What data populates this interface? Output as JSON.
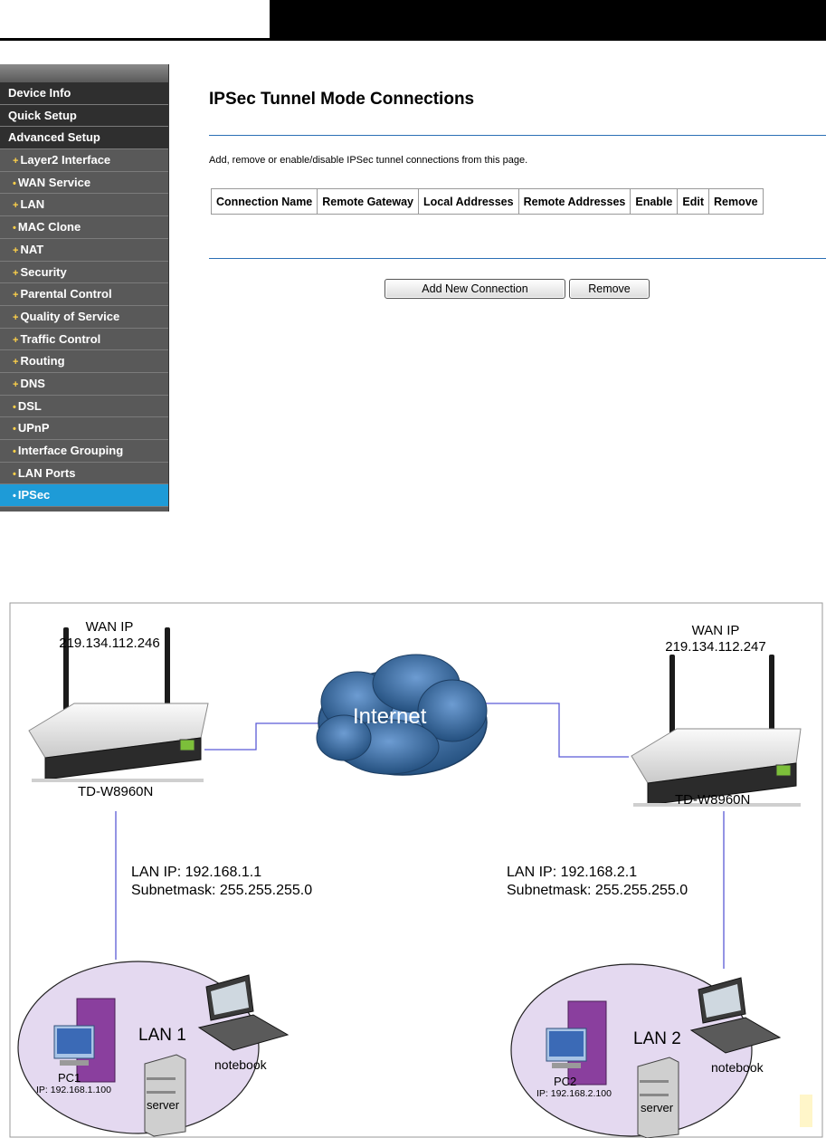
{
  "sidebar": {
    "items": [
      {
        "label": "Device Info",
        "level": "main"
      },
      {
        "label": "Quick Setup",
        "level": "main"
      },
      {
        "label": "Advanced Setup",
        "level": "main"
      },
      {
        "label": "Layer2 Interface",
        "level": "sub",
        "bullet": "+"
      },
      {
        "label": "WAN Service",
        "level": "sub",
        "bullet": "•"
      },
      {
        "label": "LAN",
        "level": "sub",
        "bullet": "+"
      },
      {
        "label": "MAC Clone",
        "level": "sub",
        "bullet": "•"
      },
      {
        "label": "NAT",
        "level": "sub",
        "bullet": "+"
      },
      {
        "label": "Security",
        "level": "sub",
        "bullet": "+"
      },
      {
        "label": "Parental Control",
        "level": "sub",
        "bullet": "+"
      },
      {
        "label": "Quality of Service",
        "level": "sub",
        "bullet": "+"
      },
      {
        "label": "Traffic Control",
        "level": "sub",
        "bullet": "+"
      },
      {
        "label": "Routing",
        "level": "sub",
        "bullet": "+"
      },
      {
        "label": "DNS",
        "level": "sub",
        "bullet": "+"
      },
      {
        "label": "DSL",
        "level": "sub",
        "bullet": "•"
      },
      {
        "label": "UPnP",
        "level": "sub",
        "bullet": "•"
      },
      {
        "label": "Interface Grouping",
        "level": "sub",
        "bullet": "•"
      },
      {
        "label": "LAN Ports",
        "level": "sub",
        "bullet": "•"
      },
      {
        "label": "IPSec",
        "level": "sub",
        "bullet": "•",
        "active": true
      }
    ]
  },
  "main": {
    "title": "IPSec Tunnel Mode Connections",
    "description": "Add, remove or enable/disable IPSec tunnel connections from this page.",
    "table_headers": [
      "Connection Name",
      "Remote Gateway",
      "Local Addresses",
      "Remote Addresses",
      "Enable",
      "Edit",
      "Remove"
    ],
    "add_button": "Add New Connection",
    "remove_button": "Remove"
  },
  "diagram": {
    "left_wan_label": "WAN IP",
    "left_wan_ip": "219.134.112.246",
    "right_wan_label": "WAN IP",
    "right_wan_ip": "219.134.112.247",
    "internet_label": "Internet",
    "left_router_model": "TD-W8960N",
    "right_router_model": "TD-W8960N",
    "left_lan_ip": "LAN IP: 192.168.1.1",
    "left_subnet": "Subnetmask: 255.255.255.0",
    "right_lan_ip": "LAN IP: 192.168.2.1",
    "right_subnet": "Subnetmask: 255.255.255.0",
    "lan1_label": "LAN 1",
    "lan2_label": "LAN 2",
    "pc1_label": "PC1",
    "pc1_ip": "IP: 192.168.1.100",
    "pc2_label": "PC2",
    "pc2_ip": "IP: 192.168.2.100",
    "server_label": "server",
    "notebook_label": "notebook"
  },
  "colors": {
    "nav_active": "#1e9bd7",
    "rule": "#2a6fb5",
    "cloud": "#3b6ea5",
    "lan_ellipse": "#e4d9f0",
    "link_line": "#5a5ad6"
  }
}
